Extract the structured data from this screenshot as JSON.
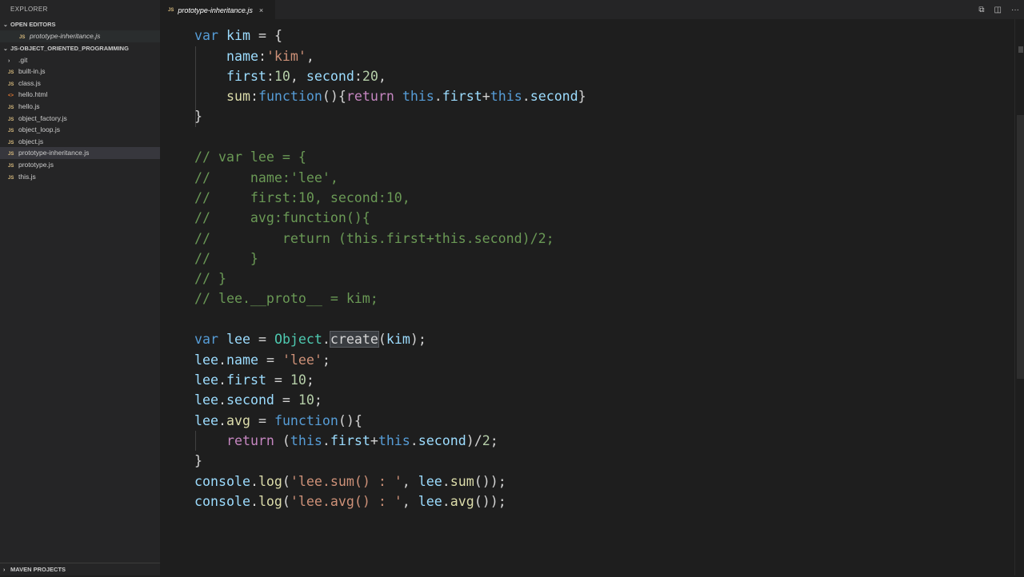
{
  "sidebar": {
    "title": "EXPLORER",
    "open_editors_label": "OPEN EDITORS",
    "open_editors": [
      {
        "badge": "JS",
        "name": "prototype-inheritance.js"
      }
    ],
    "project_label": "JS-OBJECT_ORIENTED_PROGRAMMING",
    "files": [
      {
        "badge": "›",
        "type": "folder",
        "name": ".git"
      },
      {
        "badge": "JS",
        "type": "js",
        "name": "built-in.js"
      },
      {
        "badge": "JS",
        "type": "js",
        "name": "class.js"
      },
      {
        "badge": "<>",
        "type": "html",
        "name": "hello.html"
      },
      {
        "badge": "JS",
        "type": "js",
        "name": "hello.js"
      },
      {
        "badge": "JS",
        "type": "js",
        "name": "object_factory.js"
      },
      {
        "badge": "JS",
        "type": "js",
        "name": "object_loop.js"
      },
      {
        "badge": "JS",
        "type": "js",
        "name": "object.js"
      },
      {
        "badge": "JS",
        "type": "js",
        "name": "prototype-inheritance.js",
        "selected": true
      },
      {
        "badge": "JS",
        "type": "js",
        "name": "prototype.js"
      },
      {
        "badge": "JS",
        "type": "js",
        "name": "this.js"
      }
    ],
    "bottom_label": "MAVEN PROJECTS"
  },
  "tab": {
    "badge": "JS",
    "name": "prototype-inheritance.js",
    "close": "×"
  },
  "actions": [
    {
      "icon": "open-changes-icon",
      "glyph": "⧉"
    },
    {
      "icon": "split-editor-icon",
      "glyph": "◫"
    },
    {
      "icon": "more-actions-icon",
      "glyph": "···"
    }
  ],
  "code": [
    {
      "indent": 0,
      "tokens": [
        [
          "kw",
          "var"
        ],
        [
          "pl",
          " "
        ],
        [
          "prop",
          "kim"
        ],
        [
          "pl",
          " = {"
        ]
      ]
    },
    {
      "indent": 1,
      "tokens": [
        [
          "prop",
          "name"
        ],
        [
          "pl",
          ":"
        ],
        [
          "str",
          "'kim'"
        ],
        [
          "pl",
          ","
        ]
      ]
    },
    {
      "indent": 1,
      "tokens": [
        [
          "prop",
          "first"
        ],
        [
          "pl",
          ":"
        ],
        [
          "num",
          "10"
        ],
        [
          "pl",
          ", "
        ],
        [
          "prop",
          "second"
        ],
        [
          "pl",
          ":"
        ],
        [
          "num",
          "20"
        ],
        [
          "pl",
          ","
        ]
      ]
    },
    {
      "indent": 1,
      "tokens": [
        [
          "fn",
          "sum"
        ],
        [
          "pl",
          ":"
        ],
        [
          "kw",
          "function"
        ],
        [
          "pl",
          "(){"
        ],
        [
          "cf",
          "return"
        ],
        [
          "pl",
          " "
        ],
        [
          "kw",
          "this"
        ],
        [
          "pl",
          "."
        ],
        [
          "prop",
          "first"
        ],
        [
          "pl",
          "+"
        ],
        [
          "kw",
          "this"
        ],
        [
          "pl",
          "."
        ],
        [
          "prop",
          "second"
        ],
        [
          "pl",
          "}"
        ]
      ]
    },
    {
      "indent": 0,
      "tokens": [
        [
          "pl",
          "}"
        ]
      ]
    },
    {
      "indent": 0,
      "tokens": []
    },
    {
      "indent": 0,
      "tokens": [
        [
          "cm",
          "// var lee = {"
        ]
      ]
    },
    {
      "indent": 0,
      "tokens": [
        [
          "cm",
          "//     name:'lee',"
        ]
      ]
    },
    {
      "indent": 0,
      "tokens": [
        [
          "cm",
          "//     first:10, second:10,"
        ]
      ]
    },
    {
      "indent": 0,
      "tokens": [
        [
          "cm",
          "//     avg:function(){"
        ]
      ]
    },
    {
      "indent": 0,
      "tokens": [
        [
          "cm",
          "//         return (this.first+this.second)/2;"
        ]
      ]
    },
    {
      "indent": 0,
      "tokens": [
        [
          "cm",
          "//     }"
        ]
      ]
    },
    {
      "indent": 0,
      "tokens": [
        [
          "cm",
          "// }"
        ]
      ]
    },
    {
      "indent": 0,
      "tokens": [
        [
          "cm",
          "// lee.__proto__ = kim;"
        ]
      ]
    },
    {
      "indent": 0,
      "tokens": []
    },
    {
      "indent": 0,
      "tokens": [
        [
          "kw",
          "var"
        ],
        [
          "pl",
          " "
        ],
        [
          "prop",
          "lee"
        ],
        [
          "pl",
          " = "
        ],
        [
          "cls",
          "Object"
        ],
        [
          "pl",
          "."
        ],
        [
          "hl",
          "create"
        ],
        [
          "pl",
          "("
        ],
        [
          "prop",
          "kim"
        ],
        [
          "pl",
          ");"
        ]
      ]
    },
    {
      "indent": 0,
      "tokens": [
        [
          "prop",
          "lee"
        ],
        [
          "pl",
          "."
        ],
        [
          "prop",
          "name"
        ],
        [
          "pl",
          " = "
        ],
        [
          "str",
          "'lee'"
        ],
        [
          "pl",
          ";"
        ]
      ]
    },
    {
      "indent": 0,
      "tokens": [
        [
          "prop",
          "lee"
        ],
        [
          "pl",
          "."
        ],
        [
          "prop",
          "first"
        ],
        [
          "pl",
          " = "
        ],
        [
          "num",
          "10"
        ],
        [
          "pl",
          ";"
        ]
      ]
    },
    {
      "indent": 0,
      "tokens": [
        [
          "prop",
          "lee"
        ],
        [
          "pl",
          "."
        ],
        [
          "prop",
          "second"
        ],
        [
          "pl",
          " = "
        ],
        [
          "num",
          "10"
        ],
        [
          "pl",
          ";"
        ]
      ]
    },
    {
      "indent": 0,
      "tokens": [
        [
          "prop",
          "lee"
        ],
        [
          "pl",
          "."
        ],
        [
          "fn",
          "avg"
        ],
        [
          "pl",
          " = "
        ],
        [
          "kw",
          "function"
        ],
        [
          "pl",
          "(){"
        ]
      ]
    },
    {
      "indent": 1,
      "tokens": [
        [
          "cf",
          "return"
        ],
        [
          "pl",
          " ("
        ],
        [
          "kw",
          "this"
        ],
        [
          "pl",
          "."
        ],
        [
          "prop",
          "first"
        ],
        [
          "pl",
          "+"
        ],
        [
          "kw",
          "this"
        ],
        [
          "pl",
          "."
        ],
        [
          "prop",
          "second"
        ],
        [
          "pl",
          ")/"
        ],
        [
          "num",
          "2"
        ],
        [
          "pl",
          ";"
        ]
      ]
    },
    {
      "indent": 0,
      "tokens": [
        [
          "pl",
          "}"
        ]
      ]
    },
    {
      "indent": 0,
      "tokens": [
        [
          "prop",
          "console"
        ],
        [
          "pl",
          "."
        ],
        [
          "fn",
          "log"
        ],
        [
          "pl",
          "("
        ],
        [
          "str",
          "'lee.sum() : '"
        ],
        [
          "pl",
          ", "
        ],
        [
          "prop",
          "lee"
        ],
        [
          "pl",
          "."
        ],
        [
          "fn",
          "sum"
        ],
        [
          "pl",
          "());"
        ]
      ]
    },
    {
      "indent": 0,
      "tokens": [
        [
          "prop",
          "console"
        ],
        [
          "pl",
          "."
        ],
        [
          "fn",
          "log"
        ],
        [
          "pl",
          "("
        ],
        [
          "str",
          "'lee.avg() : '"
        ],
        [
          "pl",
          ", "
        ],
        [
          "prop",
          "lee"
        ],
        [
          "pl",
          "."
        ],
        [
          "fn",
          "avg"
        ],
        [
          "pl",
          "());"
        ]
      ]
    }
  ],
  "code_line_tops": [
    8,
    34,
    59,
    84,
    109,
    135,
    160,
    186,
    211,
    236,
    262,
    287,
    312,
    337,
    363,
    388,
    414,
    439,
    464,
    490,
    515,
    540,
    566,
    591
  ]
}
